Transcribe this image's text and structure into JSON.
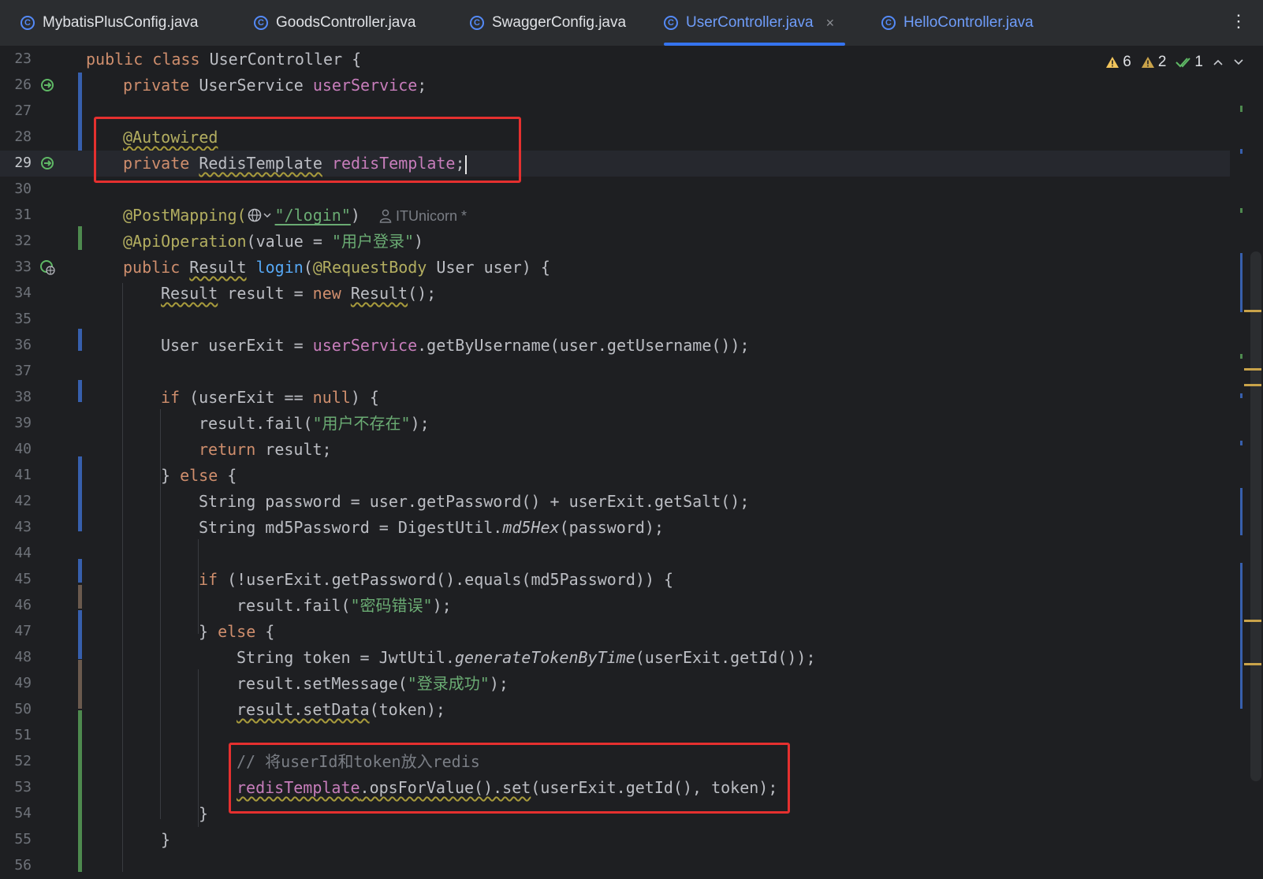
{
  "tabs": [
    {
      "label": "MybatisPlusConfig.java",
      "active": false
    },
    {
      "label": "GoodsController.java",
      "active": false
    },
    {
      "label": "SwaggerConfig.java",
      "active": false
    },
    {
      "label": "UserController.java",
      "active": true
    },
    {
      "label": "HelloController.java",
      "active": false
    }
  ],
  "tab_icon_letter": "C",
  "tab_close": "×",
  "more_menu": "⋮",
  "inspections": {
    "warnings": "6",
    "weak_warnings": "2",
    "ok": "1"
  },
  "lines": {
    "23": {
      "num": "23",
      "code": "public class UserController {"
    },
    "26": {
      "num": "26",
      "code": "private UserService userService;"
    },
    "27": {
      "num": "27"
    },
    "28": {
      "num": "28",
      "code": "@Autowired"
    },
    "29": {
      "num": "29",
      "code": "private RedisTemplate redisTemplate;"
    },
    "30": {
      "num": "30"
    },
    "31": {
      "num": "31",
      "code": "@PostMapping(\"/login\")",
      "hint": "ITUnicorn *"
    },
    "32": {
      "num": "32",
      "code": "@ApiOperation(value = \"用户登录\")"
    },
    "33": {
      "num": "33",
      "code": "public Result login(@RequestBody User user) {"
    },
    "34": {
      "num": "34",
      "code": "Result result = new Result();"
    },
    "35": {
      "num": "35"
    },
    "36": {
      "num": "36",
      "code": "User userExit = userService.getByUsername(user.getUsername());"
    },
    "37": {
      "num": "37"
    },
    "38": {
      "num": "38",
      "code": "if (userExit == null) {"
    },
    "39": {
      "num": "39",
      "code": "result.fail(\"用户不存在\");"
    },
    "40": {
      "num": "40",
      "code": "return result;"
    },
    "41": {
      "num": "41",
      "code": "} else {"
    },
    "42": {
      "num": "42",
      "code": "String password = user.getPassword() + userExit.getSalt();"
    },
    "43": {
      "num": "43",
      "code": "String md5Password = DigestUtil.md5Hex(password);"
    },
    "44": {
      "num": "44"
    },
    "45": {
      "num": "45",
      "code": "if (!userExit.getPassword().equals(md5Password)) {"
    },
    "46": {
      "num": "46",
      "code": "result.fail(\"密码错误\");"
    },
    "47": {
      "num": "47",
      "code": "} else {"
    },
    "48": {
      "num": "48",
      "code": "String token = JwtUtil.generateTokenByTime(userExit.getId());"
    },
    "49": {
      "num": "49",
      "code": "result.setMessage(\"登录成功\");"
    },
    "50": {
      "num": "50",
      "code": "result.setData(token);"
    },
    "51": {
      "num": "51"
    },
    "52": {
      "num": "52",
      "code": "// 将userId和token放入redis"
    },
    "53": {
      "num": "53",
      "code": "redisTemplate.opsForValue().set(userExit.getId(), token);"
    },
    "54": {
      "num": "54",
      "code": "}"
    },
    "55": {
      "num": "55",
      "code": "}"
    },
    "56": {
      "num": "56"
    }
  },
  "tokens": {
    "public": "public",
    "class": "class",
    "private": "private",
    "new": "new",
    "if": "if",
    "return": "return",
    "else": "else",
    "null": "null",
    "UserController": "UserController {",
    "UserService": "UserService",
    "userService": "userService",
    "semi": ";",
    "Autowired": "@Autowired",
    "RedisTemplate": "RedisTemplate",
    "redisTemplate": "redisTemplate",
    "PostMapping": "@PostMapping(",
    "login_str": "\"/login\"",
    "rparen": ")",
    "ApiOperation": "@ApiOperation",
    "value_eq": "(value = ",
    "s_login_title": "\"用户登录\"",
    "Result": "Result",
    "login": "login",
    "RequestBody": "@RequestBody",
    "user_param": " User user) {",
    "lparen": "(",
    "result_eq": " result = ",
    "paren_semi": "();",
    "userExit_decl": "User userExit = ",
    "getByUsername": ".getByUsername(user.getUsername());",
    "userExit_null": " (userExit == ",
    "brace_open": ") {",
    "result_fail": "result.fail(",
    "s_not_exist": "\"用户不存在\"",
    "close_semi": ");",
    "result_semi": " result;",
    "close_brace": "}",
    "open_brace": " {",
    "pwd_line": "String password = user.getPassword() + userExit.getSalt();",
    "md5_pre": "String md5Password = DigestUtil.",
    "md5Hex": "md5Hex",
    "md5_post": "(password);",
    "if_equals": " (!userExit.getPassword().equals(md5Password)) {",
    "s_wrong_pwd": "\"密码错误\"",
    "token_pre": "String token = JwtUtil.",
    "genToken": "generateTokenByTime",
    "token_post": "(userExit.getId());",
    "setMessage": "result.setMessage(",
    "s_success": "\"登录成功\"",
    "setData": "result.setData",
    "setData_post": "(token);",
    "comment": "// 将userId和token放入redis",
    "opsForValue": ".opsForValue().set",
    "set_args": "(userExit.getId(), token);"
  },
  "colors": {
    "highlight_box": "#e5302f",
    "accent": "#3574f0",
    "background": "#1e1f22"
  }
}
